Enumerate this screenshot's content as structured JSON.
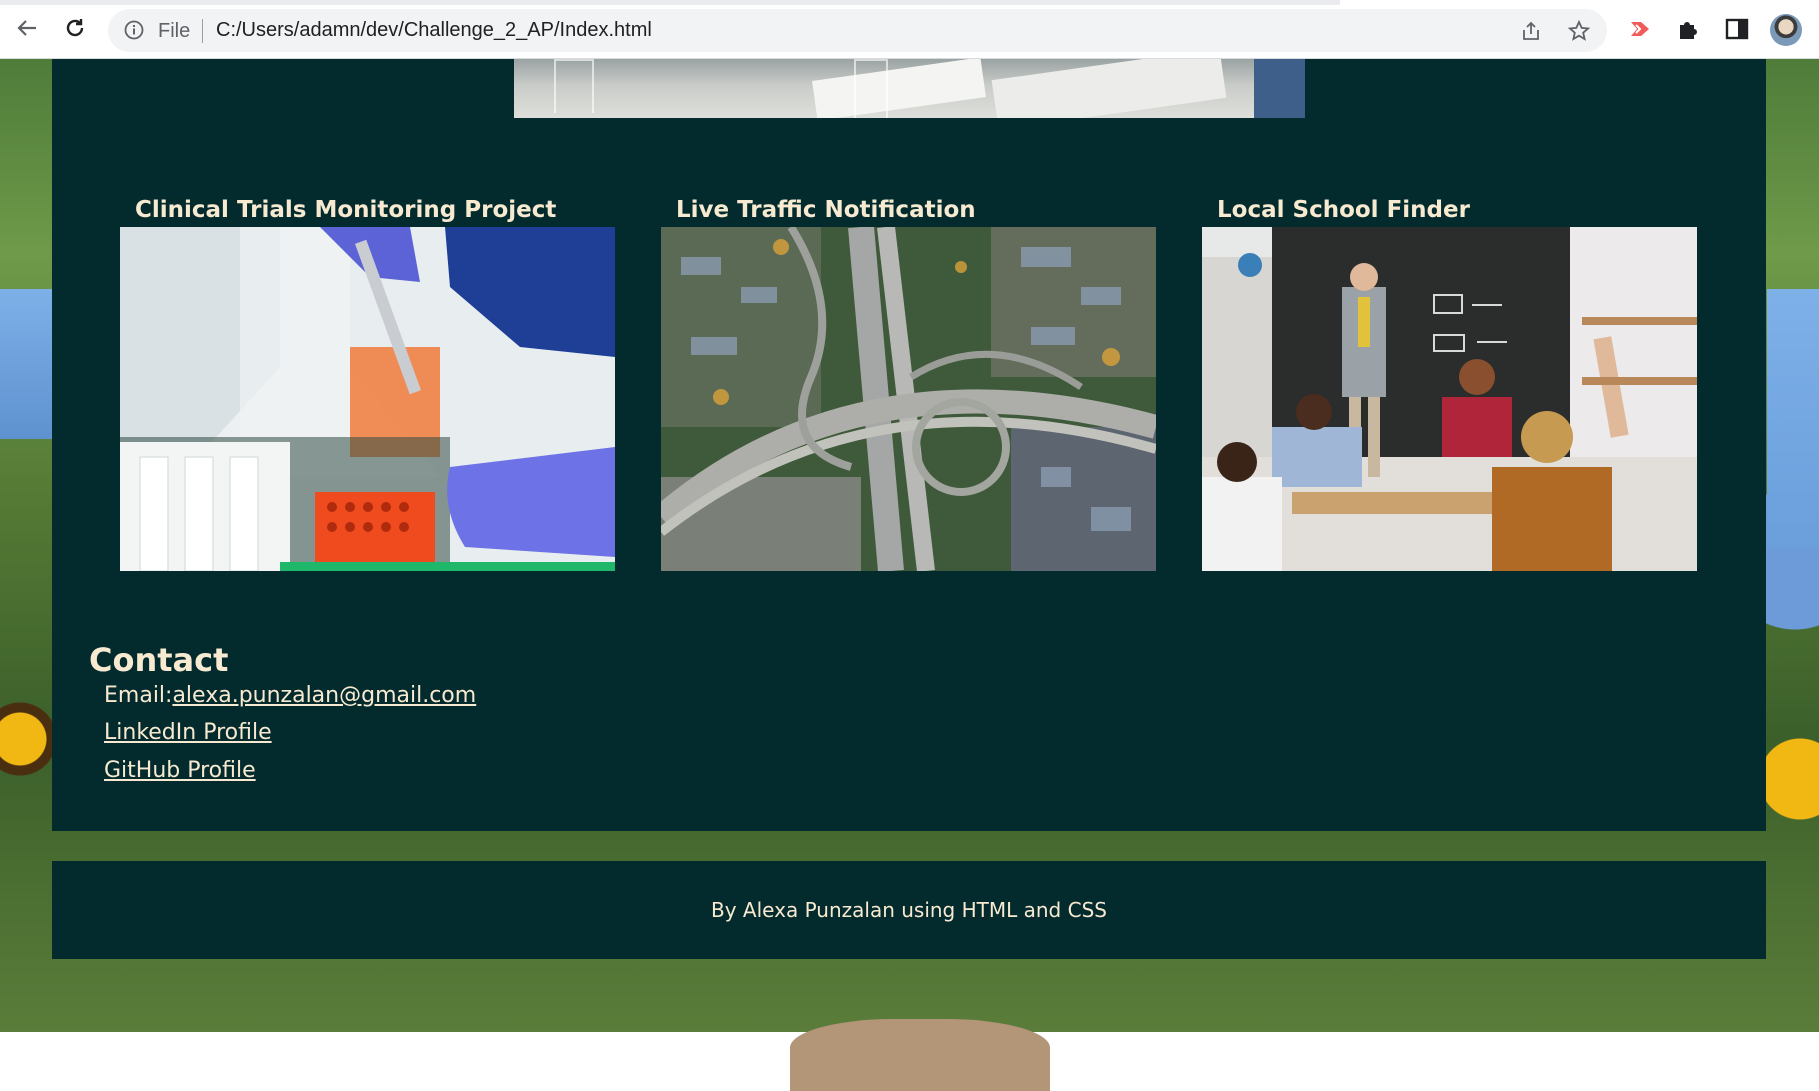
{
  "browser": {
    "url_scheme_label": "File",
    "url": "C:/Users/adamn/dev/Challenge_2_AP/Index.html",
    "icons": [
      "back-icon",
      "reload-icon",
      "info-icon",
      "share-icon",
      "bookmark-star-icon",
      "extension-red-icon",
      "puzzle-extensions-icon",
      "side-panel-icon",
      "profile-avatar"
    ]
  },
  "projects": [
    {
      "title": "Clinical Trials Monitoring Project",
      "image": "laboratory-pipette-photo"
    },
    {
      "title": "Live Traffic Notification",
      "image": "highway-interchange-aerial-photo"
    },
    {
      "title": "Local School Finder",
      "image": "classroom-photo"
    }
  ],
  "contact": {
    "heading": "Contact",
    "email_label": "Email:",
    "email": "alexa.punzalan@gmail.com",
    "linkedin": "LinkedIn Profile",
    "github": "GitHub Profile"
  },
  "footer": {
    "text": "By Alexa Punzalan using HTML and CSS"
  },
  "colors": {
    "panel_bg": "#032b2e",
    "text": "#f7ead0"
  }
}
